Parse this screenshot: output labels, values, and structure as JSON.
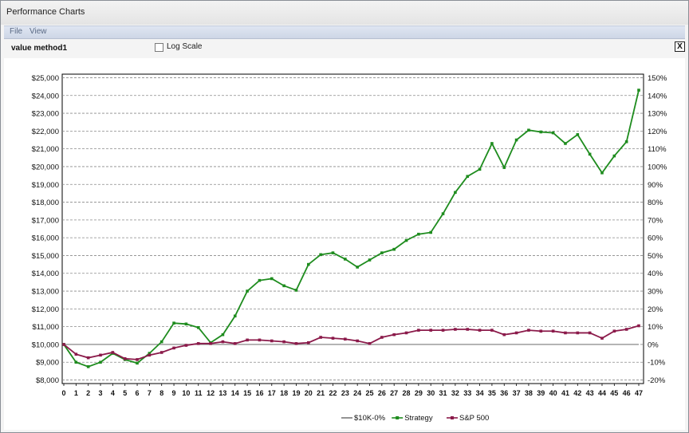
{
  "window": {
    "title": "Performance Charts"
  },
  "menu": {
    "file": "File",
    "view": "View"
  },
  "toolbar": {
    "method_label": "value method1",
    "log_scale_label": "Log Scale",
    "log_scale_checked": false,
    "close_label": "X"
  },
  "chart_data": {
    "type": "line",
    "title": "",
    "xlabel": "",
    "ylabel": "",
    "ylim": [
      7800,
      25200
    ],
    "y2lim": [
      -0.22,
      1.52
    ],
    "grid": true,
    "legend_placement": "bottom",
    "y_ticks": [
      "$8,000",
      "$9,000",
      "$10,000",
      "$11,000",
      "$12,000",
      "$13,000",
      "$14,000",
      "$15,000",
      "$16,000",
      "$17,000",
      "$18,000",
      "$19,000",
      "$20,000",
      "$21,000",
      "$22,000",
      "$23,000",
      "$24,000",
      "$25,000"
    ],
    "y2_ticks": [
      "-20%",
      "-10%",
      "0%",
      "10%",
      "20%",
      "30%",
      "40%",
      "50%",
      "60%",
      "70%",
      "80%",
      "90%",
      "100%",
      "110%",
      "120%",
      "130%",
      "140%",
      "150%"
    ],
    "x_ticks": [
      "0",
      "1",
      "2",
      "3",
      "4",
      "5",
      "6",
      "7",
      "8",
      "9",
      "10",
      "11",
      "12",
      "13",
      "14",
      "15",
      "16",
      "17",
      "18",
      "19",
      "20",
      "21",
      "22",
      "23",
      "24",
      "25",
      "26",
      "27",
      "28",
      "29",
      "30",
      "31",
      "32",
      "33",
      "34",
      "35",
      "36",
      "37",
      "38",
      "39",
      "40",
      "41",
      "42",
      "43",
      "44",
      "45",
      "46",
      "47"
    ],
    "x": [
      0,
      1,
      2,
      3,
      4,
      5,
      6,
      7,
      8,
      9,
      10,
      11,
      12,
      13,
      14,
      15,
      16,
      17,
      18,
      19,
      20,
      21,
      22,
      23,
      24,
      25,
      26,
      27,
      28,
      29,
      30,
      31,
      32,
      33,
      34,
      35,
      36,
      37,
      38,
      39,
      40,
      41,
      42,
      43,
      44,
      45,
      46,
      47
    ],
    "series": [
      {
        "name": "$10K-0%",
        "color": "#7a7a7a",
        "values": [
          10000,
          10000,
          10000,
          10000,
          10000,
          10000,
          10000,
          10000,
          10000,
          10000,
          10000,
          10000,
          10000,
          10000,
          10000,
          10000,
          10000,
          10000,
          10000,
          10000,
          10000,
          10000,
          10000,
          10000,
          10000,
          10000,
          10000,
          10000,
          10000,
          10000,
          10000,
          10000,
          10000,
          10000,
          10000,
          10000,
          10000,
          10000,
          10000,
          10000,
          10000,
          10000,
          10000,
          10000,
          10000,
          10000,
          10000,
          10000
        ]
      },
      {
        "name": "Strategy",
        "color": "#1e8c1e",
        "values": [
          10000,
          9000,
          8750,
          9000,
          9500,
          9150,
          8950,
          9500,
          10150,
          11200,
          11150,
          10950,
          10100,
          10550,
          11600,
          13000,
          13600,
          13700,
          13300,
          13050,
          14500,
          15050,
          15150,
          14800,
          14350,
          14750,
          15150,
          15350,
          15850,
          16200,
          16300,
          17350,
          18550,
          19450,
          19850,
          21300,
          19950,
          21500,
          22050,
          21950,
          21900,
          21300,
          21800,
          20700,
          19650,
          20600,
          21400,
          24300
        ]
      },
      {
        "name": "S&P 500",
        "color": "#8b1a4a",
        "values": [
          10000,
          9450,
          9250,
          9400,
          9550,
          9200,
          9150,
          9400,
          9550,
          9800,
          9950,
          10050,
          10050,
          10150,
          10050,
          10250,
          10250,
          10200,
          10150,
          10050,
          10100,
          10400,
          10350,
          10300,
          10200,
          10050,
          10400,
          10550,
          10650,
          10800,
          10800,
          10800,
          10850,
          10850,
          10800,
          10800,
          10550,
          10650,
          10800,
          10750,
          10750,
          10650,
          10650,
          10650,
          10350,
          10750,
          10850,
          11050
        ]
      }
    ]
  }
}
